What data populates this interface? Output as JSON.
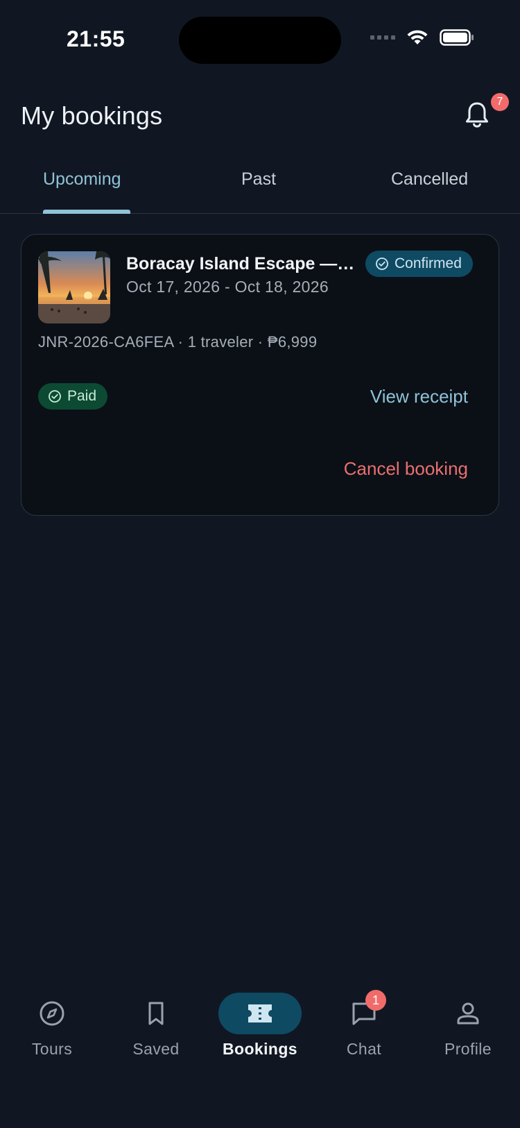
{
  "status_bar": {
    "time": "21:55"
  },
  "header": {
    "title": "My bookings",
    "notification_count": "7"
  },
  "tabs": [
    {
      "label": "Upcoming",
      "active": true
    },
    {
      "label": "Past",
      "active": false
    },
    {
      "label": "Cancelled",
      "active": false
    }
  ],
  "booking": {
    "title": "Boracay Island Escape —…",
    "dates": "Oct 17, 2026 - Oct 18, 2026",
    "status": "Confirmed",
    "meta": "JNR-2026-CA6FEA · 1 traveler · ₱6,999",
    "payment_status": "Paid",
    "view_receipt": "View receipt",
    "cancel": "Cancel booking"
  },
  "bottom_nav": [
    {
      "label": "Tours",
      "icon": "compass-icon",
      "active": false
    },
    {
      "label": "Saved",
      "icon": "bookmark-icon",
      "active": false
    },
    {
      "label": "Bookings",
      "icon": "ticket-icon",
      "active": true
    },
    {
      "label": "Chat",
      "icon": "chat-icon",
      "active": false,
      "badge": "1"
    },
    {
      "label": "Profile",
      "icon": "person-icon",
      "active": false
    }
  ],
  "colors": {
    "background": "#111722",
    "accent": "#8fc3d8",
    "danger": "#ec6f6f",
    "confirmed_bg": "#0f4a63",
    "paid_bg": "#0d4a33"
  }
}
